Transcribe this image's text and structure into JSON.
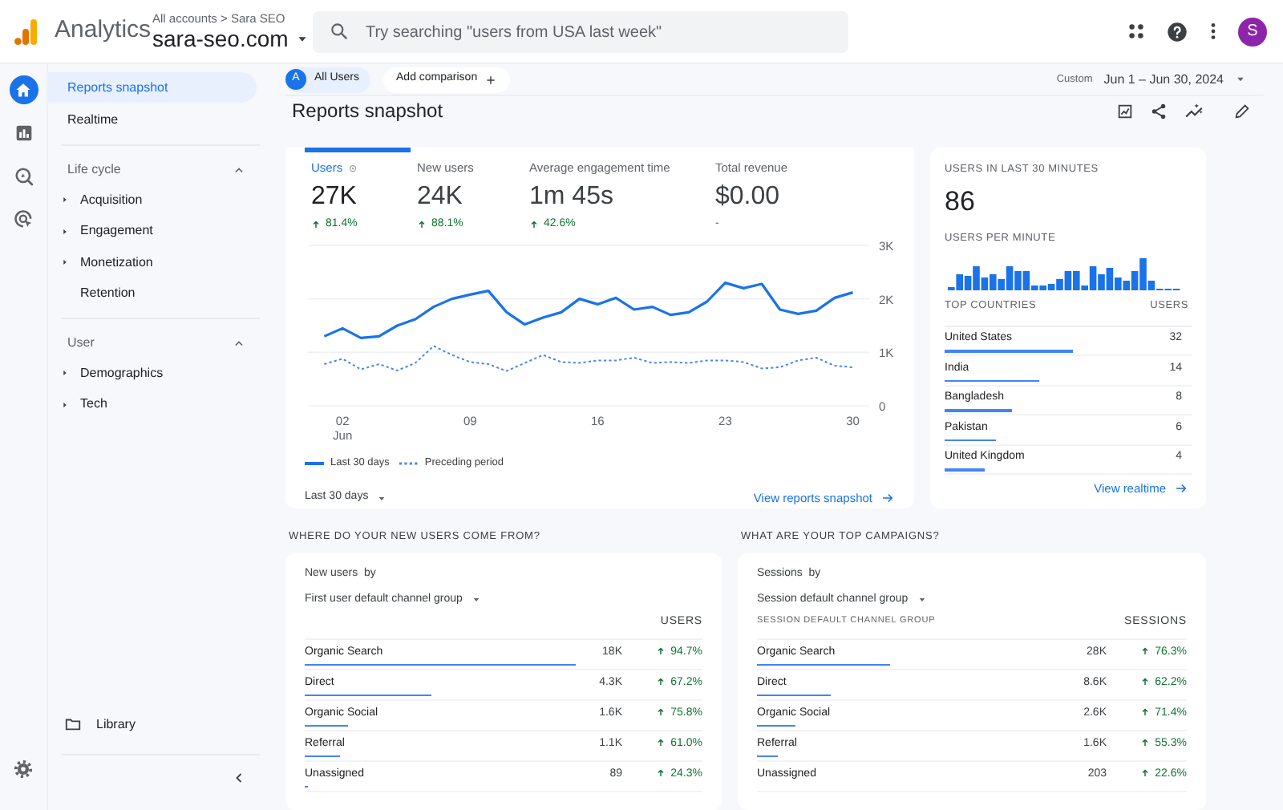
{
  "app": {
    "name": "Analytics",
    "breadcrumb": "All accounts > Sara SEO",
    "property": "sara-seo.com"
  },
  "search": {
    "placeholder": "Try searching \"users from USA last week\""
  },
  "account": {
    "initial": "S"
  },
  "rail": [
    {
      "selected": true
    },
    {
      "selected": false
    },
    {
      "selected": false
    },
    {
      "selected": false
    }
  ],
  "nav": {
    "items": [
      {
        "label": "Reports snapshot",
        "selected": true
      },
      {
        "label": "Realtime",
        "selected": false
      }
    ],
    "sections": [
      {
        "title": "Life cycle",
        "expanded": true,
        "children": [
          {
            "label": "Acquisition",
            "kind": "expandable"
          },
          {
            "label": "Engagement",
            "kind": "expandable"
          },
          {
            "label": "Monetization",
            "kind": "expandable"
          },
          {
            "label": "Retention",
            "kind": "link"
          }
        ]
      },
      {
        "title": "User",
        "expanded": true,
        "children": [
          {
            "label": "Demographics",
            "kind": "expandable"
          },
          {
            "label": "Tech",
            "kind": "expandable"
          }
        ]
      }
    ],
    "library": "Library"
  },
  "toolbar": {
    "segment_badge": "A",
    "segment": "All Users",
    "add_comparison": "Add comparison",
    "date_kind": "Custom",
    "date_range": "Jun 1 – Jun 30, 2024"
  },
  "page_title": "Reports snapshot",
  "metrics": [
    {
      "label": "Users",
      "value": "27K",
      "change": "81.4%",
      "kind": "increase",
      "selected": true
    },
    {
      "label": "New users",
      "value": "24K",
      "change": "88.1%",
      "kind": "increase",
      "selected": false
    },
    {
      "label": "Average engagement time",
      "value": "1m 45s",
      "change": "42.6%",
      "kind": "increase",
      "selected": false
    },
    {
      "label": "Total revenue",
      "value": "$0.00",
      "change": "-",
      "kind": "empty",
      "selected": false
    }
  ],
  "chart_data": {
    "type": "line",
    "x": [
      1,
      2,
      3,
      4,
      5,
      6,
      7,
      8,
      9,
      10,
      11,
      12,
      13,
      14,
      15,
      16,
      17,
      18,
      19,
      20,
      21,
      22,
      23,
      24,
      25,
      26,
      27,
      28,
      29,
      30
    ],
    "series": [
      {
        "name": "Last 30 days",
        "color": "#1a73e8",
        "line_style": "solid",
        "values": [
          1300,
          1450,
          1270,
          1300,
          1500,
          1620,
          1850,
          2000,
          2080,
          2150,
          1750,
          1520,
          1650,
          1750,
          2000,
          1900,
          2020,
          1800,
          1850,
          1700,
          1750,
          1950,
          2300,
          2200,
          2280,
          1800,
          1720,
          1780,
          2020,
          2120
        ]
      },
      {
        "name": "Preceding period",
        "color": "#4a86e8",
        "line_style": "dotted",
        "values": [
          780,
          880,
          680,
          780,
          660,
          800,
          1120,
          950,
          820,
          780,
          650,
          800,
          950,
          820,
          800,
          850,
          850,
          900,
          800,
          820,
          800,
          850,
          850,
          820,
          700,
          720,
          850,
          900,
          750,
          720
        ]
      }
    ],
    "xlim": [
      0.1,
      30.9
    ],
    "ylim": [
      0,
      3000
    ],
    "yticks": [
      {
        "value": 0,
        "label": "0"
      },
      {
        "value": 1000,
        "label": "1K"
      },
      {
        "value": 2000,
        "label": "2K"
      },
      {
        "value": 3000,
        "label": "3K"
      }
    ],
    "xticks": [
      {
        "value": 2,
        "label": "02 Jun"
      },
      {
        "value": 9,
        "label": "09"
      },
      {
        "value": 16,
        "label": "16"
      },
      {
        "value": 23,
        "label": "23"
      },
      {
        "value": 30,
        "label": "30"
      }
    ]
  },
  "chart_footer": {
    "period": "Last 30 days",
    "link": "View reports snapshot"
  },
  "realtime": {
    "title": "USERS IN LAST 30 MINUTES",
    "value": "86",
    "per_minute": "USERS PER MINUTE",
    "columns": [
      "TOP COUNTRIES",
      "USERS"
    ],
    "rows": [
      {
        "name": "United States",
        "value": "32",
        "level": 0.52
      },
      {
        "name": "India",
        "value": "14",
        "level": 0.38
      },
      {
        "name": "Bangladesh",
        "value": "8",
        "level": 0.27
      },
      {
        "name": "Pakistan",
        "value": "6",
        "level": 0.21
      },
      {
        "name": "United Kingdom",
        "value": "4",
        "level": 0.16
      }
    ],
    "link": "View realtime"
  },
  "new_users": {
    "heading": "WHERE DO YOUR NEW USERS COME FROM?",
    "metric": "New users",
    "by": "by",
    "dimension": "First user default channel group",
    "columns": [
      "USERS"
    ],
    "rows": [
      {
        "name": "Organic Search",
        "value": "18K",
        "change": "94.7%",
        "level": 0.68
      },
      {
        "name": "Direct",
        "value": "4.3K",
        "change": "67.2%",
        "level": 0.32
      },
      {
        "name": "Organic Social",
        "value": "1.6K",
        "change": "75.8%",
        "level": 0.11
      },
      {
        "name": "Referral",
        "value": "1.1K",
        "change": "61.0%",
        "level": 0.09
      },
      {
        "name": "Unassigned",
        "value": "89",
        "change": "24.3%",
        "level": 0.01
      }
    ]
  },
  "campaigns": {
    "heading": "WHAT ARE YOUR TOP CAMPAIGNS?",
    "metric": "Sessions",
    "by": "by",
    "dimension": "Session default channel group",
    "columns": [
      "SESSION DEFAULT CHANNEL GROUP",
      "SESSIONS"
    ],
    "rows": [
      {
        "name": "Organic Search",
        "value": "28K",
        "change": "76.3%",
        "level": 0.31
      },
      {
        "name": "Direct",
        "value": "8.6K",
        "change": "62.2%",
        "level": 0.17
      },
      {
        "name": "Organic Social",
        "value": "2.6K",
        "change": "71.4%",
        "level": 0.09
      },
      {
        "name": "Referral",
        "value": "1.6K",
        "change": "55.3%",
        "level": 0.05
      },
      {
        "name": "Unassigned",
        "value": "203",
        "change": "22.6%",
        "level": 0
      }
    ]
  }
}
